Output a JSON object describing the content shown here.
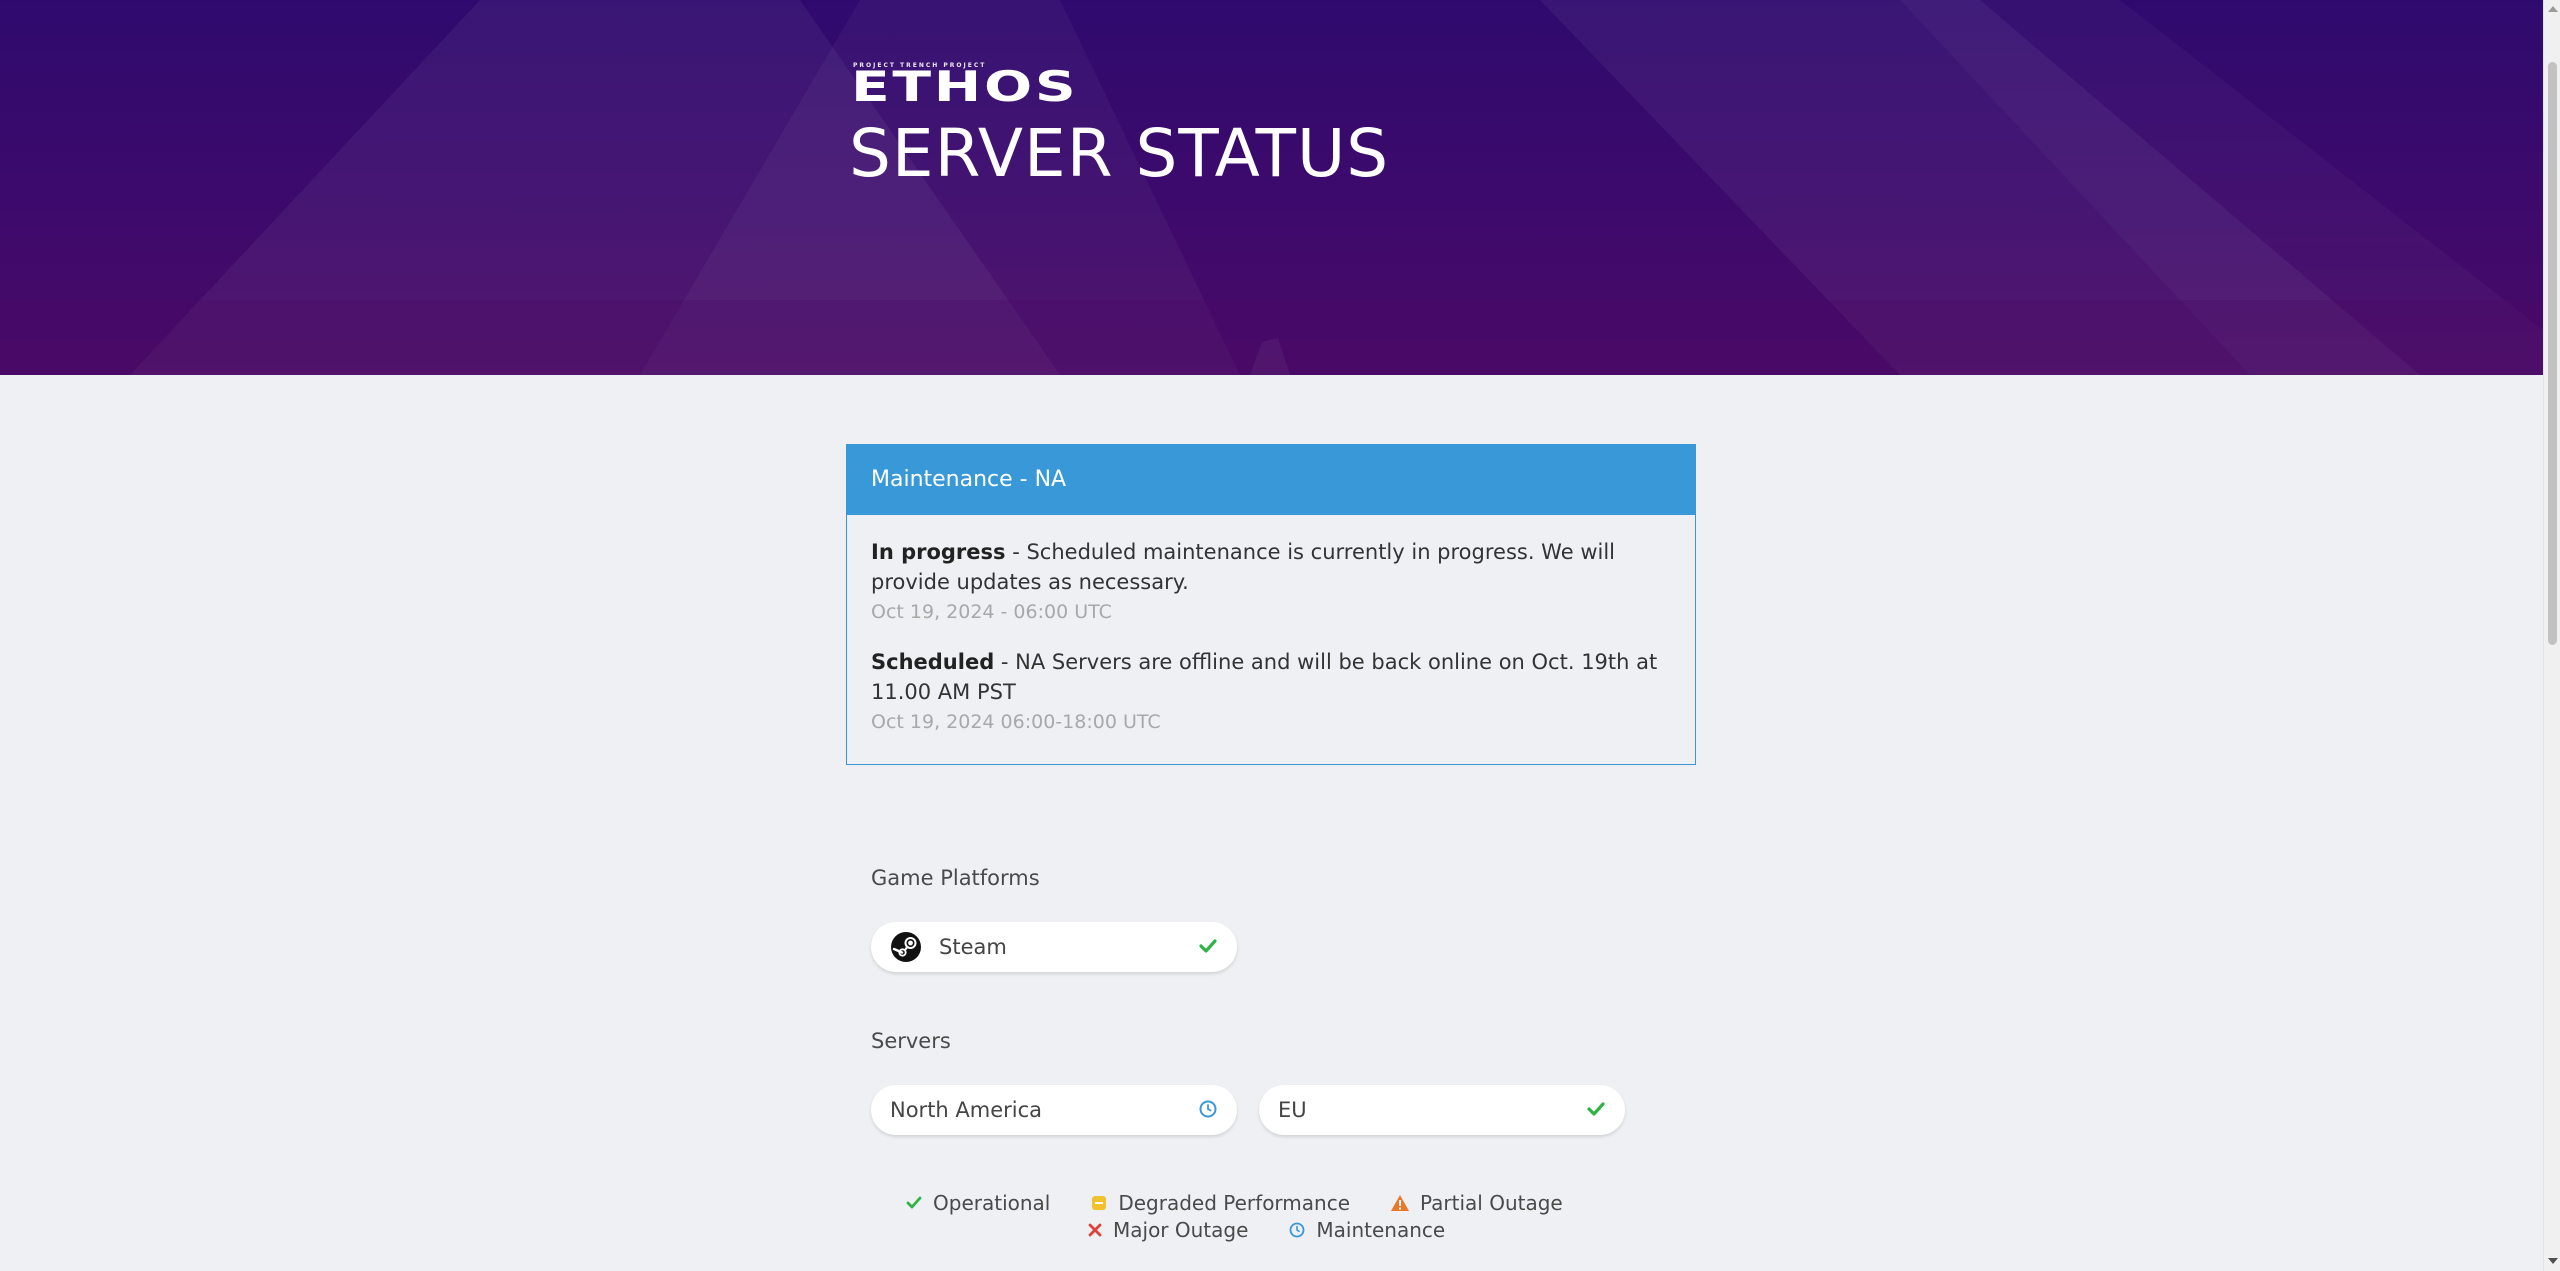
{
  "header": {
    "tagline": "PROJECT TRENCH PROJECT",
    "logo_text": "ETHOS",
    "title": "SERVER STATUS"
  },
  "incident": {
    "title": "Maintenance - NA",
    "updates": [
      {
        "status": "In progress",
        "message": " - Scheduled maintenance is currently in progress. We will provide updates as necessary.",
        "date": "Oct 19, 2024 - 06:00 UTC"
      },
      {
        "status": "Scheduled",
        "message": " - NA Servers are offline and will be back online on Oct. 19th at 11.00 AM PST",
        "date": "Oct 19, 2024 06:00-18:00 UTC"
      }
    ]
  },
  "platforms": {
    "title": "Game Platforms",
    "items": [
      {
        "label": "Steam",
        "icon": "steam-icon",
        "status": "operational"
      }
    ]
  },
  "servers": {
    "title": "Servers",
    "items": [
      {
        "label": "North America",
        "status": "maintenance"
      },
      {
        "label": "EU",
        "status": "operational"
      }
    ]
  },
  "legend": {
    "operational": "Operational",
    "degraded": "Degraded Performance",
    "partial": "Partial Outage",
    "major": "Major Outage",
    "maintenance": "Maintenance"
  },
  "colors": {
    "hero_bg": "#3d0a6c",
    "incident_header": "#3898d8",
    "operational": "#2fb344",
    "degraded": "#f2c12e",
    "partial": "#e8782a",
    "major": "#e0413a",
    "maintenance": "#3898d8"
  }
}
